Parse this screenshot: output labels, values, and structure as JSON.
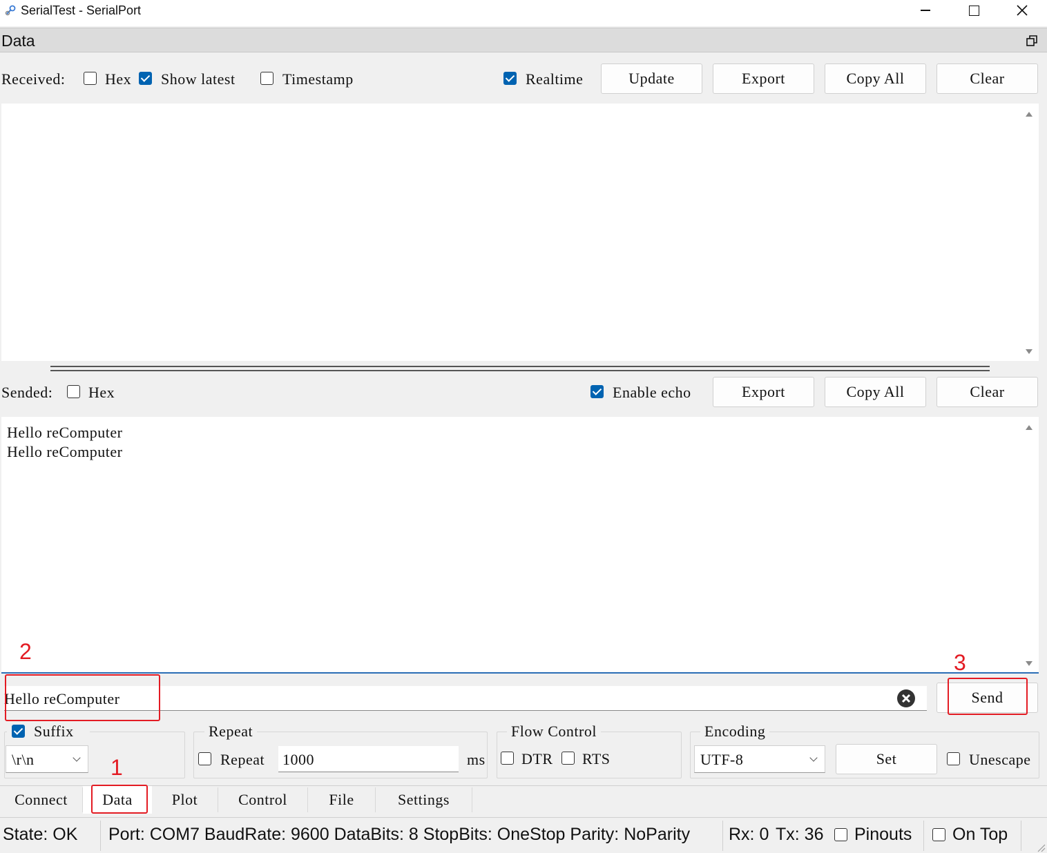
{
  "window": {
    "title": "SerialTest - SerialPort",
    "icon": "serial-link-icon"
  },
  "dock": {
    "title": "Data",
    "float_icon": "restore-icon"
  },
  "received": {
    "label": "Received:",
    "hex": {
      "label": "Hex",
      "checked": false
    },
    "show_latest": {
      "label": "Show latest",
      "checked": true
    },
    "timestamp": {
      "label": "Timestamp",
      "checked": false
    },
    "realtime": {
      "label": "Realtime",
      "checked": true
    },
    "update_label": "Update",
    "export_label": "Export",
    "copy_all_label": "Copy All",
    "clear_label": "Clear",
    "content": ""
  },
  "sended": {
    "label": "Sended:",
    "hex": {
      "label": "Hex",
      "checked": false
    },
    "enable_echo": {
      "label": "Enable echo",
      "checked": true
    },
    "export_label": "Export",
    "copy_all_label": "Copy All",
    "clear_label": "Clear",
    "lines": [
      "Hello reComputer",
      "Hello reComputer"
    ]
  },
  "input": {
    "value": "Hello reComputer",
    "send_label": "Send"
  },
  "options": {
    "suffix": {
      "label": "Suffix",
      "checked": true,
      "value": "\\r\\n"
    },
    "repeat_group": "Repeat",
    "repeat": {
      "label": "Repeat",
      "checked": false,
      "interval": "1000",
      "unit": "ms"
    },
    "flow_control": "Flow Control",
    "dtr": {
      "label": "DTR",
      "checked": false
    },
    "rts": {
      "label": "RTS",
      "checked": false
    },
    "encoding_group": "Encoding",
    "encoding": "UTF-8",
    "set_label": "Set",
    "unescape": {
      "label": "Unescape",
      "checked": false
    }
  },
  "tabs": [
    "Connect",
    "Data",
    "Plot",
    "Control",
    "File",
    "Settings"
  ],
  "active_tab": "Data",
  "annotations": [
    "1",
    "2",
    "3"
  ],
  "annotation_color": "#e31b23",
  "status": {
    "state": "State: OK",
    "port_info": "Port: COM7 BaudRate: 9600 DataBits: 8 StopBits: OneStop Parity: NoParity",
    "rx": "Rx: 0",
    "tx": "Tx: 36",
    "pinouts": {
      "label": "Pinouts",
      "checked": false
    },
    "on_top": {
      "label": "On Top",
      "checked": false
    }
  }
}
